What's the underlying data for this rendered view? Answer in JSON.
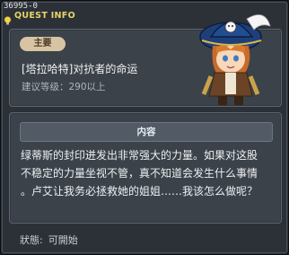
{
  "header": {
    "quest_id": "36995-0",
    "title": "QUEST INFO"
  },
  "quest": {
    "tag": "主要",
    "name": "[塔拉哈特]对抗者的命运",
    "level_req": "建议等级：290以上"
  },
  "content": {
    "header": "内容",
    "lines": [
      "绿蒂斯的封印迸发出非常强大的力量。如果对这股",
      "不稳定的力量坐视不管，真不知道会发生什么事情",
      "。卢艾让我务必拯救她的姐姐……我该怎么做呢？"
    ]
  },
  "status": {
    "label": "狀態:",
    "value": "可開始"
  },
  "colors": {
    "title": "#e8d46a",
    "tag_bg": "#d8c4a2",
    "panel_bg": "#3b424a",
    "window_bg": "#2c3137"
  },
  "icons": [
    "lightbulb-icon",
    "npc-portrait"
  ]
}
